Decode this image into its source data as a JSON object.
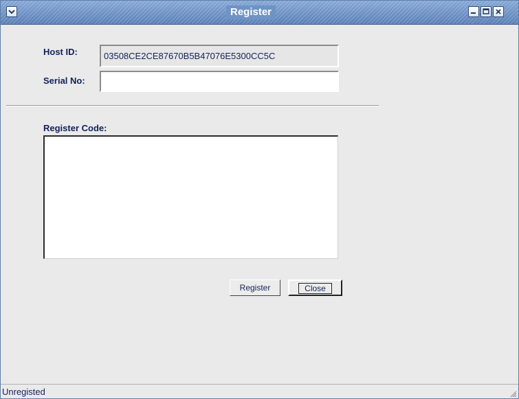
{
  "window": {
    "title": "Register",
    "controls": {
      "menu": "chevron-down-icon",
      "minimize": "minimize-icon",
      "maximize": "maximize-icon",
      "close": "close-icon"
    }
  },
  "form": {
    "host_id_label": "Host ID:",
    "host_id_value": "03508CE2CE87670B5B47076E5300CC5C",
    "serial_label": "Serial No:",
    "serial_value": "",
    "register_code_label": "Register Code:",
    "register_code_value": ""
  },
  "buttons": {
    "register": "Register",
    "close": "Close"
  },
  "status": {
    "text": "Unregisted"
  },
  "colors": {
    "titlebar": "#6f93c4",
    "label_text": "#12205a",
    "background": "#eaeaea"
  }
}
